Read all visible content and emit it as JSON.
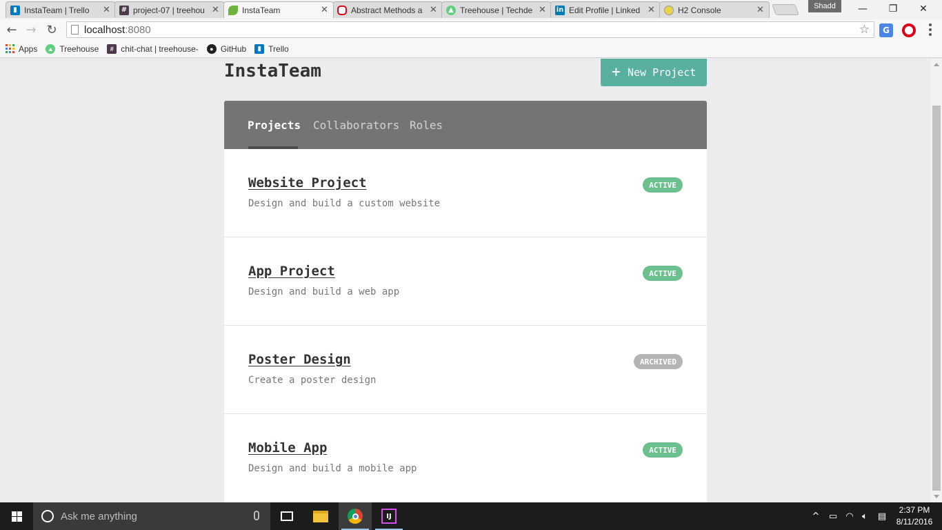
{
  "browser": {
    "tabs": [
      {
        "title": "InstaTeam | Trello",
        "icon": "trello-icon",
        "color": "#0079bf"
      },
      {
        "title": "project-07 | treehou",
        "icon": "slack-hash-icon",
        "color": "#4d394b"
      },
      {
        "title": "InstaTeam",
        "icon": "spring-leaf-icon",
        "color": "#6db33f",
        "active": true
      },
      {
        "title": "Abstract Methods a",
        "icon": "oracle-icon",
        "color": "#e0001a"
      },
      {
        "title": "Treehouse | Techde",
        "icon": "treehouse-icon",
        "color": "#5fcf80"
      },
      {
        "title": "Edit Profile | Linked",
        "icon": "linkedin-icon",
        "color": "#0077b5"
      },
      {
        "title": "H2 Console",
        "icon": "h2-icon",
        "color": "#e8d44d"
      }
    ],
    "profile_name": "Shadd",
    "address": {
      "host": "localhost",
      "port": ":8080"
    },
    "bookmarks": [
      {
        "label": "Apps",
        "icon": "apps-grid-icon"
      },
      {
        "label": "Treehouse",
        "icon": "treehouse-icon",
        "color": "#5fcf80"
      },
      {
        "label": "chit-chat | treehouse-",
        "icon": "slack-hash-icon",
        "color": "#4d394b"
      },
      {
        "label": "GitHub",
        "icon": "github-icon",
        "color": "#222222"
      },
      {
        "label": "Trello",
        "icon": "trello-icon",
        "color": "#0079bf"
      }
    ]
  },
  "app": {
    "brand": "InstaTeam",
    "new_project_label": "New Project",
    "accent_color": "#59b0a0",
    "nav_tabs": [
      {
        "label": "Projects",
        "active": true
      },
      {
        "label": "Collaborators"
      },
      {
        "label": "Roles"
      }
    ],
    "projects": [
      {
        "name": "Website Project",
        "description": "Design and build a custom website",
        "status": "ACTIVE"
      },
      {
        "name": "App Project",
        "description": "Design and build a web app",
        "status": "ACTIVE"
      },
      {
        "name": "Poster Design",
        "description": "Create a poster design",
        "status": "ARCHIVED"
      },
      {
        "name": "Mobile App",
        "description": "Design and build a mobile app",
        "status": "ACTIVE"
      }
    ],
    "status_colors": {
      "ACTIVE": "#6cc08f",
      "ARCHIVED": "#b4b4b4"
    }
  },
  "taskbar": {
    "search_placeholder": "Ask me anything",
    "time": "2:37 PM",
    "date": "8/11/2016"
  }
}
